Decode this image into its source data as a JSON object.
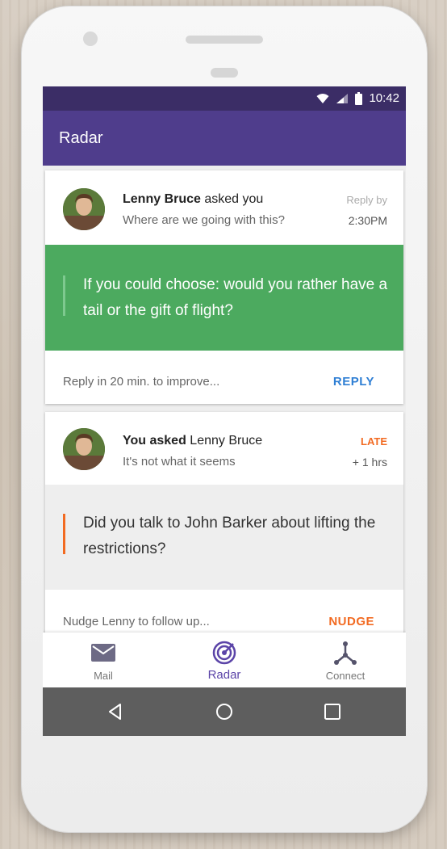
{
  "status_bar": {
    "time": "10:42"
  },
  "app_bar": {
    "title": "Radar"
  },
  "cards": [
    {
      "sender": "Lenny Bruce",
      "verb": " asked you",
      "subject": "Where are we going with this?",
      "meta_top": "Reply by",
      "meta_bottom": "2:30PM",
      "question": "If you could choose: would you rather have a tail or the gift of flight?",
      "footer": "Reply in 20 min. to improve...",
      "action": "REPLY",
      "action_color": "#2f7fd4",
      "question_bg": "#4caa5f"
    },
    {
      "sender": "You asked",
      "verb": " Lenny Bruce",
      "subject": "It's not what it seems",
      "meta_top": "LATE",
      "meta_bottom": "+ 1 hrs",
      "question": "Did you talk to John Barker about lifting the restrictions?",
      "footer": "Nudge Lenny to follow up...",
      "action": "NUDGE",
      "action_color": "#f26a21",
      "accent": "#f26a21"
    }
  ],
  "bottom_nav": [
    {
      "label": "Mail",
      "icon": "mail-icon"
    },
    {
      "label": "Radar",
      "icon": "radar-icon",
      "active": true
    },
    {
      "label": "Connect",
      "icon": "connect-icon"
    }
  ],
  "system_nav": [
    "back-icon",
    "home-icon",
    "recents-icon"
  ],
  "colors": {
    "primary": "#4f3d8c",
    "status": "#3b2d66",
    "accent": "#5b44a8"
  }
}
